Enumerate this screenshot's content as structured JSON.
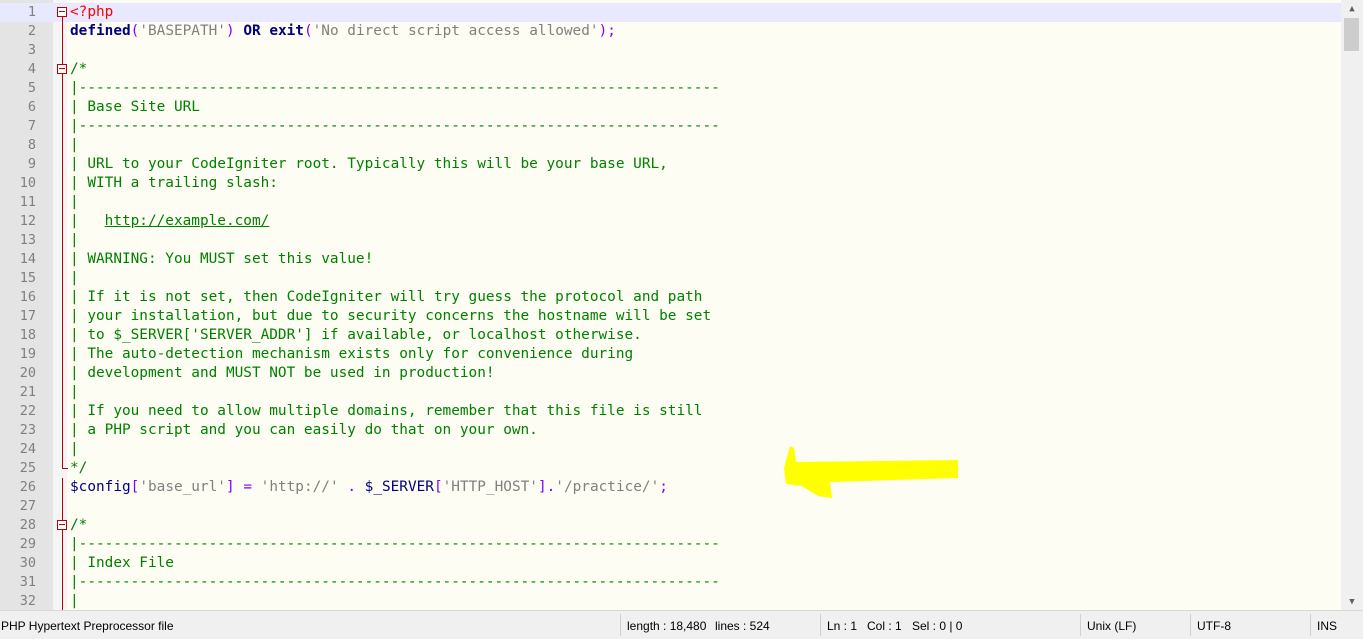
{
  "editor": {
    "lines": [
      {
        "n": "1",
        "fold": "start",
        "current": true,
        "parts": [
          [
            "tag",
            "<?php"
          ]
        ]
      },
      {
        "n": "2",
        "fold": "line",
        "parts": [
          [
            "k",
            "defined"
          ],
          [
            "op",
            "("
          ],
          [
            "s",
            "'BASEPATH'"
          ],
          [
            "op",
            ")"
          ],
          [
            "t",
            " "
          ],
          [
            "k",
            "OR"
          ],
          [
            "t",
            " "
          ],
          [
            "k",
            "exit"
          ],
          [
            "op",
            "("
          ],
          [
            "s",
            "'No direct script access allowed'"
          ],
          [
            "op",
            ");"
          ]
        ]
      },
      {
        "n": "3",
        "fold": "line",
        "parts": []
      },
      {
        "n": "4",
        "fold": "start",
        "parts": [
          [
            "c",
            "/*"
          ]
        ]
      },
      {
        "n": "5",
        "fold": "line",
        "parts": [
          [
            "c",
            "|--------------------------------------------------------------------------"
          ]
        ]
      },
      {
        "n": "6",
        "fold": "line",
        "parts": [
          [
            "c",
            "| Base Site URL"
          ]
        ]
      },
      {
        "n": "7",
        "fold": "line",
        "parts": [
          [
            "c",
            "|--------------------------------------------------------------------------"
          ]
        ]
      },
      {
        "n": "8",
        "fold": "line",
        "parts": [
          [
            "c",
            "|"
          ]
        ]
      },
      {
        "n": "9",
        "fold": "line",
        "parts": [
          [
            "c",
            "| URL to your CodeIgniter root. Typically this will be your base URL,"
          ]
        ]
      },
      {
        "n": "10",
        "fold": "line",
        "parts": [
          [
            "c",
            "| WITH a trailing slash:"
          ]
        ]
      },
      {
        "n": "11",
        "fold": "line",
        "parts": [
          [
            "c",
            "|"
          ]
        ]
      },
      {
        "n": "12",
        "fold": "line",
        "parts": [
          [
            "c",
            "|   "
          ],
          [
            "url",
            "http://example.com/"
          ]
        ]
      },
      {
        "n": "13",
        "fold": "line",
        "parts": [
          [
            "c",
            "|"
          ]
        ]
      },
      {
        "n": "14",
        "fold": "line",
        "parts": [
          [
            "c",
            "| WARNING: You MUST set this value!"
          ]
        ]
      },
      {
        "n": "15",
        "fold": "line",
        "parts": [
          [
            "c",
            "|"
          ]
        ]
      },
      {
        "n": "16",
        "fold": "line",
        "parts": [
          [
            "c",
            "| If it is not set, then CodeIgniter will try guess the protocol and path"
          ]
        ]
      },
      {
        "n": "17",
        "fold": "line",
        "parts": [
          [
            "c",
            "| your installation, but due to security concerns the hostname will be set"
          ]
        ]
      },
      {
        "n": "18",
        "fold": "line",
        "parts": [
          [
            "c",
            "| to $_SERVER['SERVER_ADDR'] if available, or localhost otherwise."
          ]
        ]
      },
      {
        "n": "19",
        "fold": "line",
        "parts": [
          [
            "c",
            "| The auto-detection mechanism exists only for convenience during"
          ]
        ]
      },
      {
        "n": "20",
        "fold": "line",
        "parts": [
          [
            "c",
            "| development and MUST NOT be used in production!"
          ]
        ]
      },
      {
        "n": "21",
        "fold": "line",
        "parts": [
          [
            "c",
            "|"
          ]
        ]
      },
      {
        "n": "22",
        "fold": "line",
        "parts": [
          [
            "c",
            "| If you need to allow multiple domains, remember that this file is still"
          ]
        ]
      },
      {
        "n": "23",
        "fold": "line",
        "parts": [
          [
            "c",
            "| a PHP script and you can easily do that on your own."
          ]
        ]
      },
      {
        "n": "24",
        "fold": "line",
        "parts": [
          [
            "c",
            "|"
          ]
        ]
      },
      {
        "n": "25",
        "fold": "end",
        "parts": [
          [
            "c",
            "*/"
          ]
        ]
      },
      {
        "n": "26",
        "fold": "line",
        "parts": [
          [
            "v",
            "$config"
          ],
          [
            "op",
            "["
          ],
          [
            "s",
            "'base_url'"
          ],
          [
            "op",
            "]"
          ],
          [
            "t",
            " "
          ],
          [
            "op",
            "="
          ],
          [
            "t",
            " "
          ],
          [
            "s",
            "'http://'"
          ],
          [
            "t",
            " "
          ],
          [
            "op",
            "."
          ],
          [
            "t",
            " "
          ],
          [
            "v",
            "$_SERVER"
          ],
          [
            "op",
            "["
          ],
          [
            "s",
            "'HTTP_HOST'"
          ],
          [
            "op",
            "]"
          ],
          [
            "op",
            "."
          ],
          [
            "s",
            "'/practice/'"
          ],
          [
            "op",
            ";"
          ]
        ]
      },
      {
        "n": "27",
        "fold": "line",
        "parts": []
      },
      {
        "n": "28",
        "fold": "start",
        "parts": [
          [
            "c",
            "/*"
          ]
        ]
      },
      {
        "n": "29",
        "fold": "line",
        "parts": [
          [
            "c",
            "|--------------------------------------------------------------------------"
          ]
        ]
      },
      {
        "n": "30",
        "fold": "line",
        "parts": [
          [
            "c",
            "| Index File"
          ]
        ]
      },
      {
        "n": "31",
        "fold": "line",
        "parts": [
          [
            "c",
            "|--------------------------------------------------------------------------"
          ]
        ]
      },
      {
        "n": "32",
        "fold": "line",
        "parts": [
          [
            "c",
            "|"
          ]
        ]
      }
    ]
  },
  "colors": {
    "keyword": "#000080",
    "string": "#808080",
    "comment": "#008000",
    "tag": "#ff0000",
    "operator": "#8000ff",
    "fold": "#c00000",
    "annotation_arrow": "#ffff00"
  },
  "statusbar": {
    "file_type": "PHP Hypertext Preprocessor file",
    "length": "length : 18,480",
    "lines": "lines : 524",
    "ln": "Ln : 1",
    "col": "Col : 1",
    "sel": "Sel : 0 | 0",
    "eol": "Unix (LF)",
    "encoding": "UTF-8",
    "mode": "INS"
  },
  "scrollbar": {
    "up_icon": "chevron-up-icon",
    "down_icon": "chevron-down-icon"
  }
}
